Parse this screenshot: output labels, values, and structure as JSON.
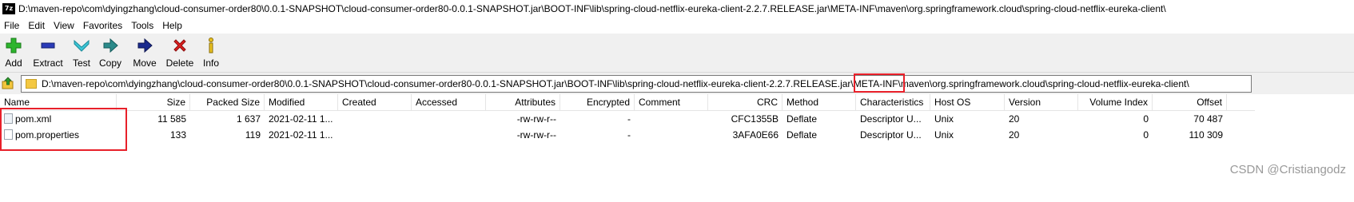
{
  "window": {
    "app_icon": "7z",
    "title": "D:\\maven-repo\\com\\dyingzhang\\cloud-consumer-order80\\0.0.1-SNAPSHOT\\cloud-consumer-order80-0.0.1-SNAPSHOT.jar\\BOOT-INF\\lib\\spring-cloud-netflix-eureka-client-2.2.7.RELEASE.jar\\META-INF\\maven\\org.springframework.cloud\\spring-cloud-netflix-eureka-client\\"
  },
  "menu": [
    "File",
    "Edit",
    "View",
    "Favorites",
    "Tools",
    "Help"
  ],
  "toolbar": {
    "add": "Add",
    "extract": "Extract",
    "test": "Test",
    "copy": "Copy",
    "move": "Move",
    "delete": "Delete",
    "info": "Info"
  },
  "address": {
    "part1": "D:\\maven-repo\\com\\dyingzhang\\cloud-consumer-order80\\0.0.1-SNAPSHOT\\cloud-consumer-order80-0.0.1-SNAPSHOT.jar\\BOOT-INF\\lib\\spring-cloud-netflix-eureka-client-2.2.7.RELEASE.jar\\",
    "part2": "META-INF\\",
    "part3": "maven\\org.springframework.cloud\\spring-cloud-netflix-eureka-client\\"
  },
  "columns": {
    "name": "Name",
    "size": "Size",
    "packed": "Packed Size",
    "modified": "Modified",
    "created": "Created",
    "accessed": "Accessed",
    "attributes": "Attributes",
    "encrypted": "Encrypted",
    "comment": "Comment",
    "crc": "CRC",
    "method": "Method",
    "characteristics": "Characteristics",
    "hostos": "Host OS",
    "version": "Version",
    "volume": "Volume Index",
    "offset": "Offset"
  },
  "files": [
    {
      "name": "pom.xml",
      "size": "11 585",
      "packed": "1 637",
      "modified": "2021-02-11 1...",
      "attributes": "-rw-rw-r--",
      "encrypted": "-",
      "crc": "CFC1355B",
      "method": "Deflate",
      "characteristics": "Descriptor U...",
      "hostos": "Unix",
      "version": "20",
      "volume": "0",
      "offset": "70 487"
    },
    {
      "name": "pom.properties",
      "size": "133",
      "packed": "119",
      "modified": "2021-02-11 1...",
      "attributes": "-rw-rw-r--",
      "encrypted": "-",
      "crc": "3AFA0E66",
      "method": "Deflate",
      "characteristics": "Descriptor U...",
      "hostos": "Unix",
      "version": "20",
      "volume": "0",
      "offset": "110 309"
    }
  ],
  "watermark": "CSDN @Cristiangodz"
}
